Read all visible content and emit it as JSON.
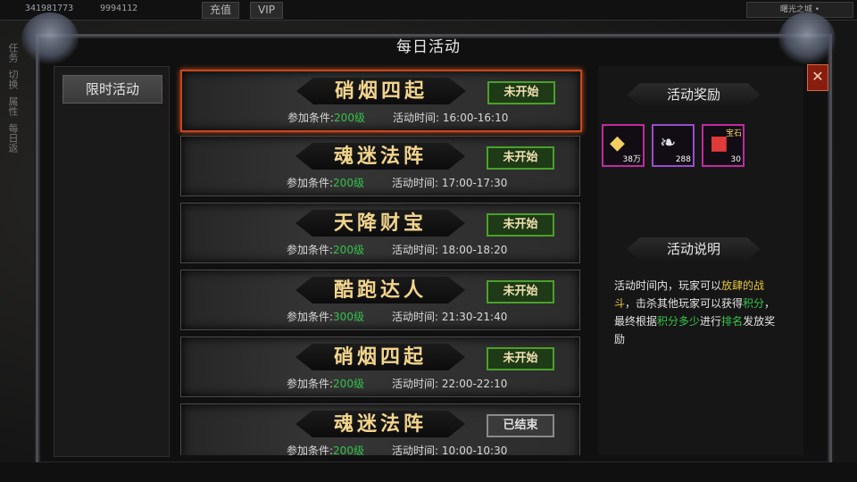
{
  "hud": {
    "value_a": "341981773",
    "value_b": "9994112",
    "recharge": "充值",
    "vip": "VIP",
    "right_label": "曙光之城 •",
    "side_labels": [
      "任务",
      "切换",
      "属性",
      "每日返"
    ]
  },
  "window": {
    "title": "每日活动",
    "close_symbol": "✕"
  },
  "tabs": [
    {
      "label": "限时活动"
    }
  ],
  "activities": [
    {
      "name": "硝烟四起",
      "status": "未开始",
      "ended": false,
      "req_label": "参加条件:",
      "req_level": "200级",
      "time_label": "活动时间:",
      "time": "16:00-16:10"
    },
    {
      "name": "魂迷法阵",
      "status": "未开始",
      "ended": false,
      "req_label": "参加条件:",
      "req_level": "200级",
      "time_label": "活动时间:",
      "time": "17:00-17:30"
    },
    {
      "name": "天降财宝",
      "status": "未开始",
      "ended": false,
      "req_label": "参加条件:",
      "req_level": "200级",
      "time_label": "活动时间:",
      "time": "18:00-18:20"
    },
    {
      "name": "酷跑达人",
      "status": "未开始",
      "ended": false,
      "req_label": "参加条件:",
      "req_level": "300级",
      "time_label": "活动时间:",
      "time": "21:30-21:40"
    },
    {
      "name": "硝烟四起",
      "status": "未开始",
      "ended": false,
      "req_label": "参加条件:",
      "req_level": "200级",
      "time_label": "活动时间:",
      "time": "22:00-22:10"
    },
    {
      "name": "魂迷法阵",
      "status": "已结束",
      "ended": true,
      "req_label": "参加条件:",
      "req_level": "200级",
      "time_label": "活动时间:",
      "time": "10:00-10:30"
    }
  ],
  "rewards": {
    "title": "活动奖励",
    "items": [
      {
        "icon": "gold-ingot-icon",
        "count": "38万"
      },
      {
        "icon": "feather-icon",
        "count": "288"
      },
      {
        "icon": "gem-gift-icon",
        "count": "30",
        "tag": "宝石"
      }
    ]
  },
  "description": {
    "title": "活动说明",
    "parts": [
      {
        "text": "活动时间内，玩家可以",
        "color": "w"
      },
      {
        "text": "放肆的战斗",
        "color": "y"
      },
      {
        "text": "，击杀其他玩家可以获得",
        "color": "w"
      },
      {
        "text": "积分",
        "color": "g"
      },
      {
        "text": "，最终根据",
        "color": "w"
      },
      {
        "text": "积分多少",
        "color": "g"
      },
      {
        "text": "进行",
        "color": "w"
      },
      {
        "text": "排名",
        "color": "g"
      },
      {
        "text": "发放奖励",
        "color": "w"
      }
    ]
  },
  "colors": {
    "accent_gold": "#f2d48c",
    "level_green": "#33c04a",
    "highlight_yellow": "#e6c53b",
    "selected_border": "#c8471f"
  }
}
